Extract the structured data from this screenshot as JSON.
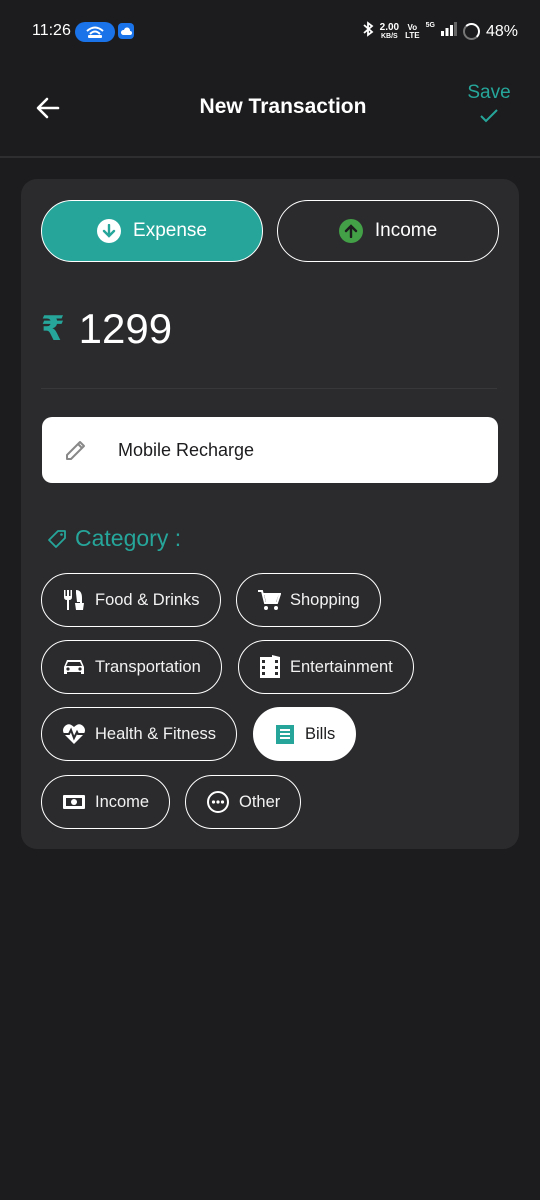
{
  "status_bar": {
    "time": "11:26",
    "net_speed": "2.00",
    "net_unit": "KB/S",
    "volte_top": "Vo",
    "volte_bottom": "LTE",
    "network": "5G",
    "battery": "48%"
  },
  "header": {
    "title": "New Transaction",
    "save_label": "Save"
  },
  "type_toggle": {
    "expense_label": "Expense",
    "income_label": "Income",
    "selected": "Expense"
  },
  "amount": {
    "currency_symbol": "₹",
    "value": "1299"
  },
  "note": {
    "value": "Mobile Recharge"
  },
  "category": {
    "heading": "Category :",
    "selected": "Bills",
    "items": [
      {
        "label": "Food & Drinks",
        "icon": "fork-knife-icon"
      },
      {
        "label": "Shopping",
        "icon": "shopping-cart-icon"
      },
      {
        "label": "Transportation",
        "icon": "car-icon"
      },
      {
        "label": "Entertainment",
        "icon": "film-icon"
      },
      {
        "label": "Health & Fitness",
        "icon": "heart-pulse-icon"
      },
      {
        "label": "Bills",
        "icon": "receipt-icon"
      },
      {
        "label": "Income",
        "icon": "money-icon"
      },
      {
        "label": "Other",
        "icon": "more-icon"
      }
    ]
  },
  "colors": {
    "accent": "#26a69a",
    "background": "#1c1c1e",
    "card": "#2b2b2e",
    "income_arrow": "#43a047"
  }
}
